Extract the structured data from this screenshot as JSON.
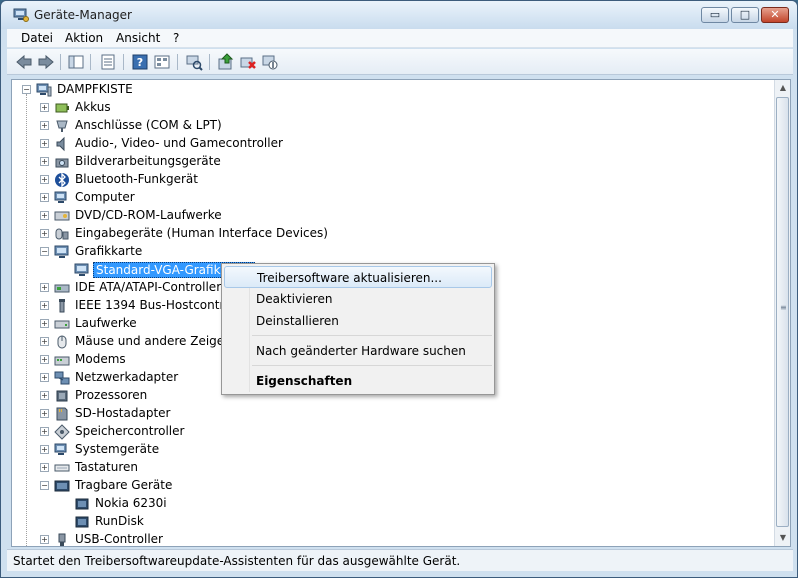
{
  "window": {
    "title": "Geräte-Manager",
    "buttons": {
      "minimize": "▭",
      "maximize": "□",
      "close": "✕"
    }
  },
  "menubar": [
    "Datei",
    "Aktion",
    "Ansicht",
    "?"
  ],
  "toolbar": {
    "icons": [
      "back-arrow-icon",
      "forward-arrow-icon",
      "console-tree-icon",
      "properties-icon",
      "help-icon",
      "view-icon",
      "scan-hardware-icon",
      "update-driver-icon",
      "uninstall-icon",
      "disable-icon"
    ]
  },
  "tree": {
    "root": "DAMPFKISTE",
    "items": [
      {
        "label": "Akkus",
        "icon": "battery-icon",
        "expander": "+"
      },
      {
        "label": "Anschlüsse (COM & LPT)",
        "icon": "port-icon",
        "expander": "+"
      },
      {
        "label": "Audio-, Video- und Gamecontroller",
        "icon": "speaker-icon",
        "expander": "+"
      },
      {
        "label": "Bildverarbeitungsgeräte",
        "icon": "camera-icon",
        "expander": "+"
      },
      {
        "label": "Bluetooth-Funkgerät",
        "icon": "bluetooth-icon",
        "expander": "+"
      },
      {
        "label": "Computer",
        "icon": "computer-icon",
        "expander": "+"
      },
      {
        "label": "DVD/CD-ROM-Laufwerke",
        "icon": "dvd-icon",
        "expander": "+"
      },
      {
        "label": "Eingabegeräte (Human Interface Devices)",
        "icon": "hid-icon",
        "expander": "+"
      },
      {
        "label": "Grafikkarte",
        "icon": "monitor-icon",
        "expander": "−"
      },
      {
        "label": "Standard-VGA-Grafikkarte",
        "icon": "display-adapter-icon",
        "child": true,
        "selected": true
      },
      {
        "label": "IDE ATA/ATAPI-Controller",
        "icon": "ide-icon",
        "expander": "+"
      },
      {
        "label": "IEEE 1394 Bus-Hostcontroller",
        "icon": "firewire-icon",
        "expander": "+"
      },
      {
        "label": "Laufwerke",
        "icon": "drive-icon",
        "expander": "+"
      },
      {
        "label": "Mäuse und andere Zeigegeräte",
        "icon": "mouse-icon",
        "expander": "+"
      },
      {
        "label": "Modems",
        "icon": "modem-icon",
        "expander": "+"
      },
      {
        "label": "Netzwerkadapter",
        "icon": "network-icon",
        "expander": "+"
      },
      {
        "label": "Prozessoren",
        "icon": "cpu-icon",
        "expander": "+"
      },
      {
        "label": "SD-Hostadapter",
        "icon": "sd-card-icon",
        "expander": "+"
      },
      {
        "label": "Speichercontroller",
        "icon": "storage-icon",
        "expander": "+"
      },
      {
        "label": "Systemgeräte",
        "icon": "system-icon",
        "expander": "+"
      },
      {
        "label": "Tastaturen",
        "icon": "keyboard-icon",
        "expander": "+"
      },
      {
        "label": "Tragbare Geräte",
        "icon": "portable-device-icon",
        "expander": "−"
      },
      {
        "label": "Nokia 6230i",
        "icon": "phone-icon",
        "child": true
      },
      {
        "label": "RunDisk",
        "icon": "phone-icon",
        "child": true
      },
      {
        "label": "USB-Controller",
        "icon": "usb-icon",
        "expander": "+"
      }
    ]
  },
  "context_menu": {
    "items": [
      {
        "label": "Treibersoftware aktualisieren...",
        "highlighted": true
      },
      {
        "label": "Deaktivieren"
      },
      {
        "label": "Deinstallieren"
      },
      {
        "separator": true
      },
      {
        "label": "Nach geänderter Hardware suchen"
      },
      {
        "separator": true
      },
      {
        "label": "Eigenschaften",
        "bold": true
      }
    ]
  },
  "status": "Startet den Treibersoftwareupdate-Assistenten für das ausgewählte Gerät.",
  "colors": {
    "selection": "#3399ff",
    "menu_highlight": "#dbeaf8"
  }
}
